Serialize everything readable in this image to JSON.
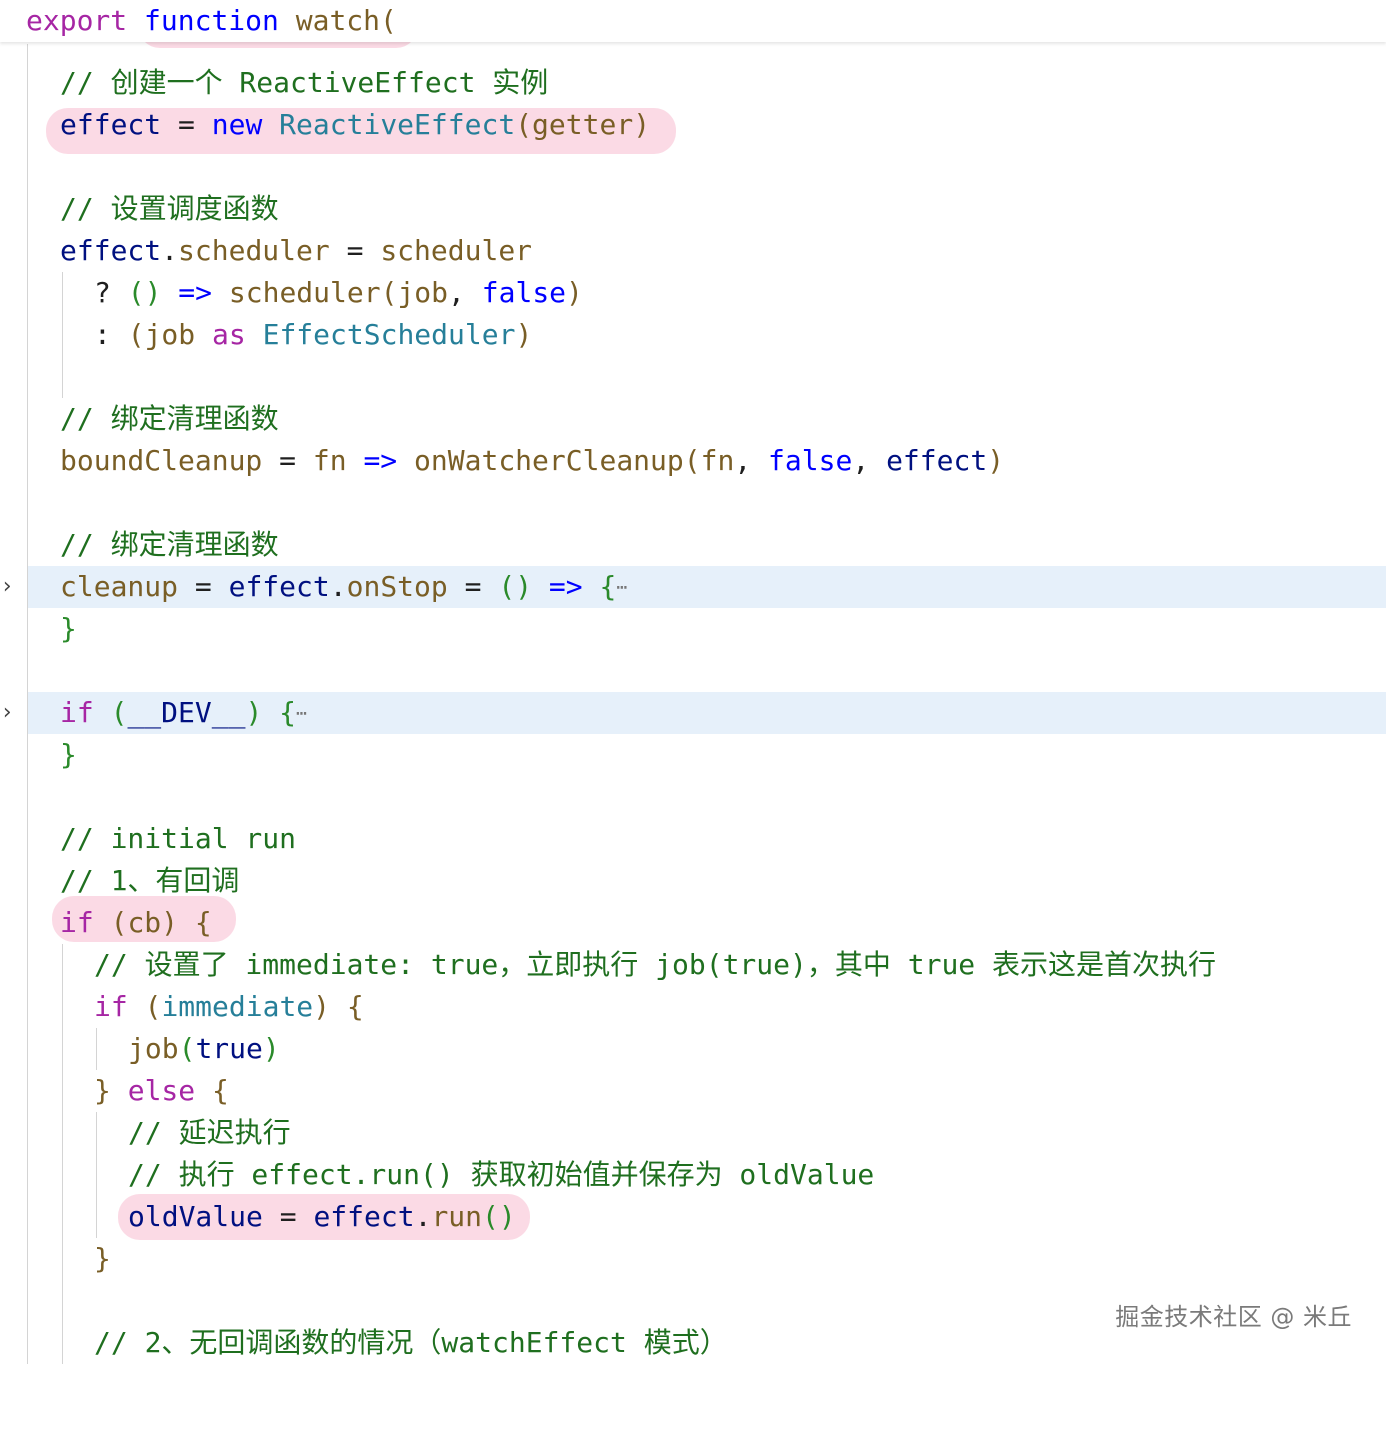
{
  "header": {
    "export_kw": "export",
    "function_kw": "function",
    "fn_name": "watch",
    "paren": "("
  },
  "lines": {
    "c1": "// 创建一个 ReactiveEffect 实例",
    "l2_effect": "effect",
    "l2_eq": " = ",
    "l2_new": "new",
    "l2_class": "ReactiveEffect",
    "l2_open": "(",
    "l2_arg": "getter",
    "l2_close": ")",
    "c3": "// 设置调度函数",
    "l4_effect": "effect",
    "l4_dot": ".",
    "l4_prop": "scheduler",
    "l4_eq": " = ",
    "l4_rhs": "scheduler",
    "l5_q": "? ",
    "l5_parens": "()",
    "l5_arrow": " => ",
    "l5_fn": "scheduler",
    "l5_open": "(",
    "l5_arg": "job",
    "l5_comma": ", ",
    "l5_false": "false",
    "l5_close": ")",
    "l6_colon": ": ",
    "l6_open": "(",
    "l6_job": "job",
    "l6_as": "as",
    "l6_type": "EffectScheduler",
    "l6_close": ")",
    "c7": "// 绑定清理函数",
    "l8_var": "boundCleanup",
    "l8_eq": " = ",
    "l8_fn_param": "fn",
    "l8_arrow": " => ",
    "l8_call": "onWatcherCleanup",
    "l8_open": "(",
    "l8_a1": "fn",
    "l8_c1": ", ",
    "l8_false": "false",
    "l8_c2": ", ",
    "l8_effect": "effect",
    "l8_close": ")",
    "c9": "// 绑定清理函数",
    "l10_var": "cleanup",
    "l10_eq": " = ",
    "l10_effect": "effect",
    "l10_dot": ".",
    "l10_prop": "onStop",
    "l10_eq2": " = ",
    "l10_parens": "()",
    "l10_arrow": " => ",
    "l10_brace": "{",
    "l10_ellipsis": "⋯",
    "l11_brace": "}",
    "l12_if": "if",
    "l12_open": " (",
    "l12_dev": "__DEV__",
    "l12_close": ") ",
    "l12_brace": "{",
    "l12_ellipsis": "⋯",
    "l13_brace": "}",
    "c14": "// initial run",
    "c15": "// 1、有回调",
    "l16_if": "if",
    "l16_open": " (",
    "l16_cb": "cb",
    "l16_close": ") ",
    "l16_brace": "{",
    "c17": "// 设置了 immediate: true，立即执行 job(true)，其中 true 表示这是首次执行",
    "l18_if": "if",
    "l18_open": " (",
    "l18_imm": "immediate",
    "l18_close": ") ",
    "l18_brace": "{",
    "l19_job": "job",
    "l19_open": "(",
    "l19_true": "true",
    "l19_close": ")",
    "l20_brace": "} ",
    "l20_else": "else",
    "l20_brace2": " {",
    "c21": "// 延迟执行",
    "c22": "// 执行 effect.run() 获取初始值并保存为 oldValue",
    "l23_var": "oldValue",
    "l23_eq": " = ",
    "l23_effect": "effect",
    "l23_dot": ".",
    "l23_run": "run",
    "l23_parens": "()",
    "l24_brace": "}",
    "c25": "// 2、无回调函数的情况（watchEffect 模式）"
  },
  "watermark": "掘金技术社区 @ 米丘",
  "colors": {
    "keyword": "#a626a4",
    "keyword_blue": "#0000ff",
    "comment": "#1f6f1f",
    "function": "#795e26",
    "variable": "#001080",
    "class": "#267f99",
    "highlight": "#fbd8e4",
    "folded_bg": "#e6f0fa"
  }
}
